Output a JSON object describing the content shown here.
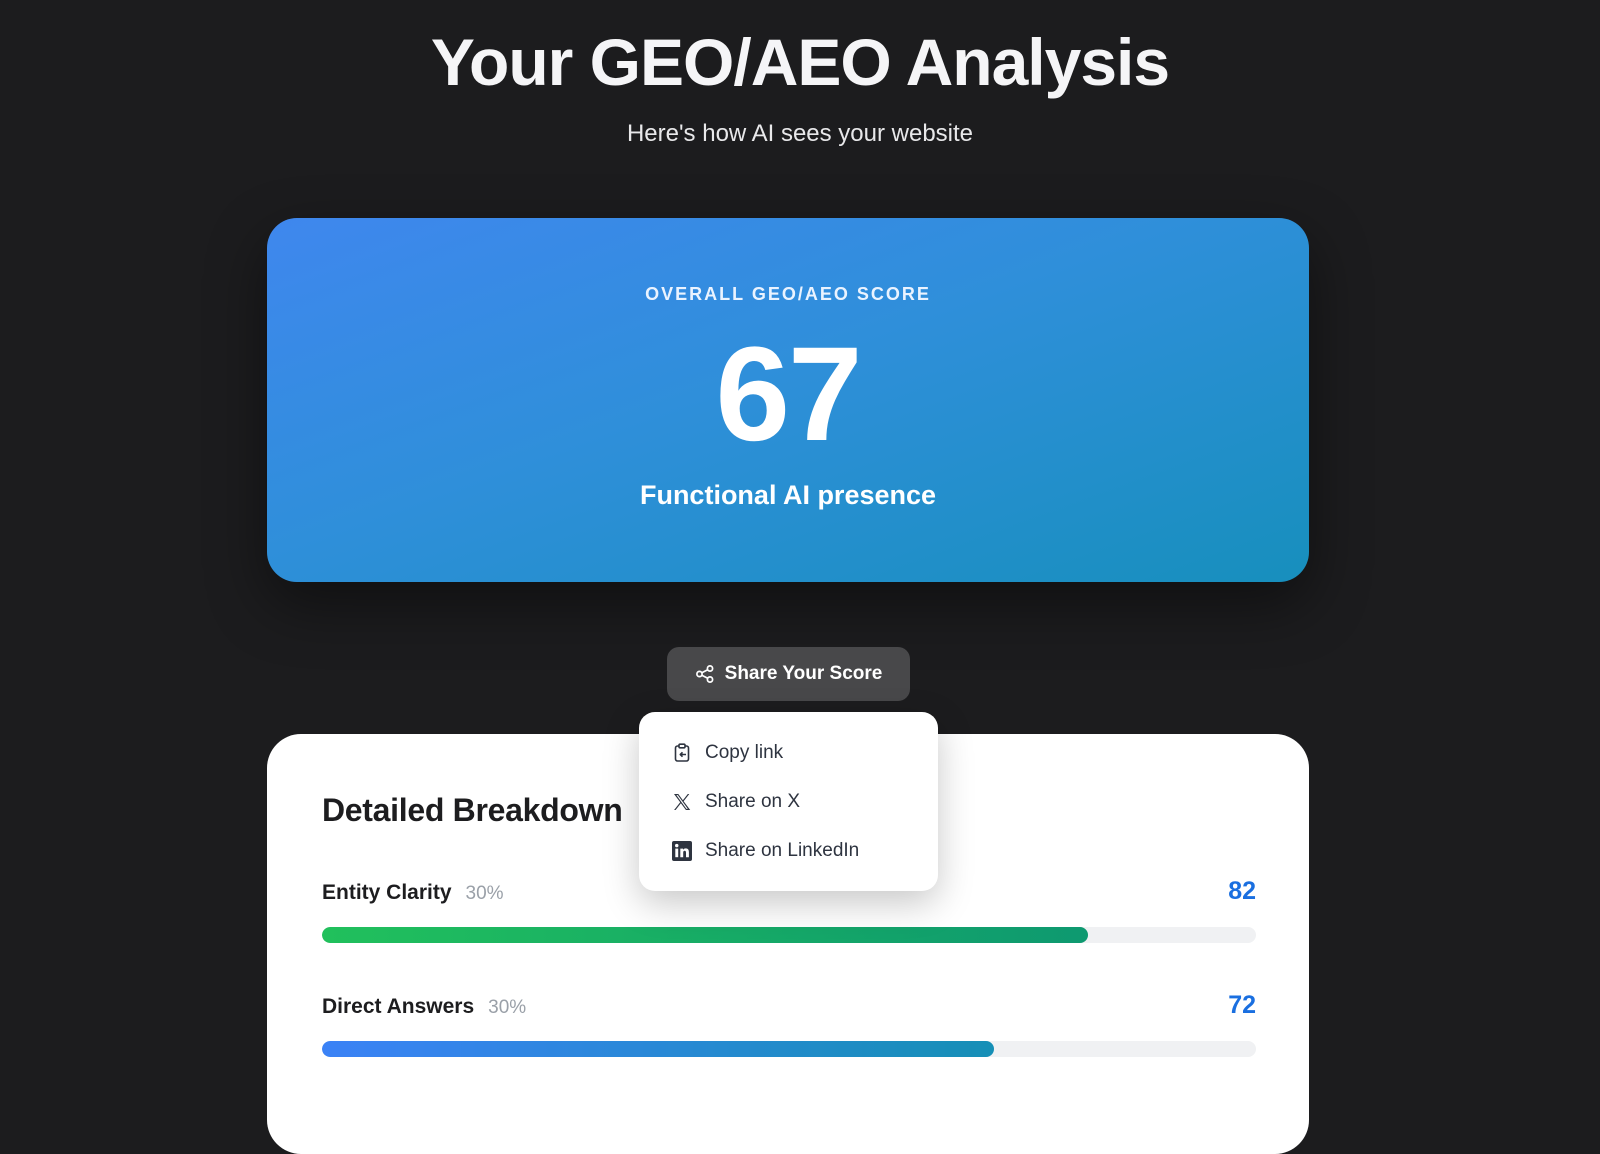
{
  "header": {
    "title": "Your GEO/AEO Analysis",
    "subtitle": "Here's how AI sees your website"
  },
  "score_card": {
    "label": "OVERALL GEO/AEO SCORE",
    "value": "67",
    "description": "Functional AI presence"
  },
  "share": {
    "button_label": "Share Your Score",
    "icon": "share-icon",
    "menu": [
      {
        "label": "Copy link",
        "icon": "clipboard-icon"
      },
      {
        "label": "Share on X",
        "icon": "x-logo-icon"
      },
      {
        "label": "Share on LinkedIn",
        "icon": "linkedin-icon"
      }
    ]
  },
  "breakdown": {
    "title": "Detailed Breakdown",
    "metrics": [
      {
        "name": "Entity Clarity",
        "weight": "30%",
        "score": "82",
        "progress": 0.82,
        "color": "#21c05c"
      },
      {
        "name": "Direct Answers",
        "weight": "30%",
        "score": "72",
        "progress": 0.72,
        "color": "#3b82f6"
      }
    ]
  },
  "colors": {
    "background": "#1c1c1e",
    "accent": "#1a6fe0",
    "card_gradient_start": "#3f87ee",
    "card_gradient_end": "#178fbd"
  }
}
